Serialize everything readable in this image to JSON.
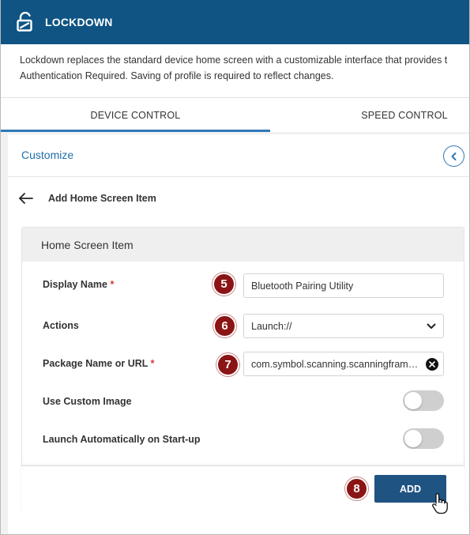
{
  "header": {
    "title": "LOCKDOWN",
    "icon": "unlock-icon",
    "background": "#0f5483"
  },
  "description": {
    "line1": "Lockdown replaces the standard device home screen with a customizable interface that provides t",
    "line2": "Authentication Required. Saving of profile is required to reflect changes."
  },
  "tabs": [
    {
      "label": "DEVICE CONTROL",
      "active": true
    },
    {
      "label": "SPEED CONTROL",
      "active": false
    }
  ],
  "section": {
    "title": "Customize",
    "collapse_icon": "chevron-left-icon"
  },
  "subpage": {
    "back_icon": "arrow-left-icon",
    "title": "Add Home Screen Item"
  },
  "card": {
    "title": "Home Screen Item",
    "fields": {
      "display_name": {
        "label": "Display Name",
        "required": "*",
        "value": "Bluetooth Pairing Utility",
        "step": "5"
      },
      "actions": {
        "label": "Actions",
        "value": "Launch://",
        "step": "6"
      },
      "package": {
        "label": "Package Name or URL",
        "required": "*",
        "value": "com.symbol.scanning.scanningframework",
        "step": "7"
      },
      "custom_image": {
        "label": "Use Custom Image",
        "on": false
      },
      "auto_launch": {
        "label": "Launch Automatically on Start-up",
        "on": false
      }
    }
  },
  "footer": {
    "add_label": "ADD",
    "step": "8"
  },
  "colors": {
    "accent": "#2e78b7",
    "button": "#1f5382",
    "step_badge": "#8b1414",
    "required": "#dd3333"
  }
}
